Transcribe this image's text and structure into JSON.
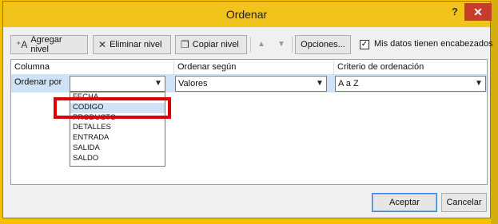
{
  "window": {
    "title": "Ordenar",
    "help_label": "?",
    "close_label": "✕"
  },
  "toolbar": {
    "add_level": "Agregar nivel",
    "delete_level": "Eliminar nivel",
    "copy_level": "Copiar nivel",
    "move_up_icon": "▲",
    "move_down_icon": "▼",
    "options": "Opciones...",
    "headers_checkbox_checked": true,
    "headers_checkbox_mark": "✓",
    "headers_label": "Mis datos tienen encabezados"
  },
  "grid": {
    "headers": {
      "column": "Columna",
      "sort_on": "Ordenar según",
      "order": "Criterio de ordenación"
    },
    "row": {
      "label": "Ordenar por",
      "column_value": "",
      "sort_on_value": "Valores",
      "order_value": "A a Z"
    }
  },
  "dropdown": {
    "items": [
      "FECHA",
      "CODIGO",
      "PRODUCTO",
      "DETALLES",
      "ENTRADA",
      "SALIDA",
      "SALDO"
    ],
    "selected": "CODIGO"
  },
  "icons": {
    "add": "plus-icon",
    "delete": "x-icon",
    "copy": "copy-icon",
    "dropdown": "chevron-down-icon"
  },
  "footer": {
    "accept": "Aceptar",
    "cancel": "Cancelar"
  },
  "colors": {
    "titlebar": "#f2c31a",
    "close": "#c73b2c",
    "highlight": "#cfe2f6",
    "callout": "#e00000"
  }
}
